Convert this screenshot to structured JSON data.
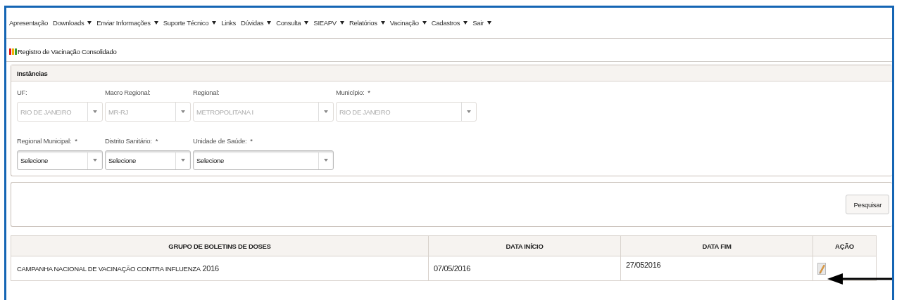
{
  "menu": [
    {
      "label": "Apresentação",
      "has_menu": false
    },
    {
      "label": "Downloads",
      "has_menu": true
    },
    {
      "label": "Enviar Informações",
      "has_menu": true
    },
    {
      "label": "Suporte Técnico",
      "has_menu": true
    },
    {
      "label": "Links",
      "has_menu": false
    },
    {
      "label": "Dúvidas",
      "has_menu": true
    },
    {
      "label": "Consulta",
      "has_menu": true
    },
    {
      "label": "SIEAPV",
      "has_menu": true
    },
    {
      "label": "Relatórios",
      "has_menu": true
    },
    {
      "label": "Vacinação",
      "has_menu": true
    },
    {
      "label": "Cadastros",
      "has_menu": true
    },
    {
      "label": "Sair",
      "has_menu": true
    }
  ],
  "page_title": "Registro de Vacinação Consolidado",
  "instancias": {
    "title": "Instâncias",
    "rows": [
      [
        {
          "label": "UF:",
          "value": "RIO DE JANEIRO",
          "disabled": true
        },
        {
          "label": "Macro Regional:",
          "value": "MR-RJ",
          "disabled": true
        },
        {
          "label": "Regional:",
          "value": "METROPOLITANA I",
          "disabled": true
        },
        {
          "label": "Município:",
          "required_mark": "*",
          "value": "RIO DE JANEIRO",
          "disabled": true
        }
      ],
      [
        {
          "label": "Regional Municipal:",
          "required_mark": "*",
          "value": "Selecione",
          "disabled": false
        },
        {
          "label": "Distrito Sanitário:",
          "required_mark": "*",
          "value": "Selecione",
          "disabled": false
        },
        {
          "label": "Unidade de Saúde:",
          "required_mark": "*",
          "value": "Selecione",
          "disabled": false
        }
      ]
    ]
  },
  "search_button": "Pesquisar",
  "table": {
    "columns": [
      "GRUPO DE BOLETINS DE DOSES",
      "DATA INÍCIO",
      "DATA FIM",
      "AÇÃO"
    ],
    "rows": [
      {
        "grupo": "CAMPANHA NACIONAL DE VACINAÇÃO CONTRA INFLUENZA",
        "ano": "2016",
        "data_inicio": "07/05/2016",
        "data_fim": "27/052016"
      }
    ]
  }
}
